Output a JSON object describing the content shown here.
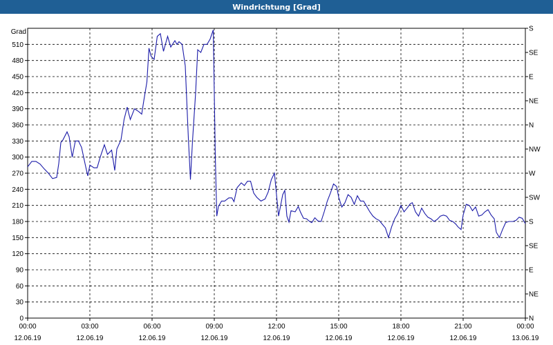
{
  "window": {
    "title": "Windrichtung [Grad]"
  },
  "colors": {
    "titlebar": "#1f5f95",
    "series": "#1a1aa8",
    "grid": "#000000"
  },
  "chart_data": {
    "type": "line",
    "title": "Windrichtung [Grad]",
    "ylabel": "Grad",
    "ylim": [
      0,
      540
    ],
    "yticks": [
      0,
      30,
      60,
      90,
      120,
      150,
      180,
      210,
      240,
      270,
      300,
      330,
      360,
      390,
      420,
      450,
      480,
      510
    ],
    "right_axis_labels": [
      "N",
      "NE",
      "E",
      "SE",
      "S",
      "SW",
      "W",
      "NW",
      "N",
      "NE",
      "E",
      "SE",
      "S"
    ],
    "right_axis_ticks": [
      0,
      45,
      90,
      135,
      180,
      225,
      270,
      315,
      360,
      405,
      450,
      495,
      540
    ],
    "xlim": [
      0,
      24
    ],
    "xticks": [
      {
        "x": 0,
        "time": "00:00",
        "date": "12.06.19"
      },
      {
        "x": 3,
        "time": "03:00",
        "date": "12.06.19"
      },
      {
        "x": 6,
        "time": "06:00",
        "date": "12.06.19"
      },
      {
        "x": 9,
        "time": "09:00",
        "date": "12.06.19"
      },
      {
        "x": 12,
        "time": "12:00",
        "date": "12.06.19"
      },
      {
        "x": 15,
        "time": "15:00",
        "date": "12.06.19"
      },
      {
        "x": 18,
        "time": "18:00",
        "date": "12.06.19"
      },
      {
        "x": 21,
        "time": "21:00",
        "date": "12.06.19"
      },
      {
        "x": 24,
        "time": "00:00",
        "date": "13.06.19"
      }
    ],
    "grid": true,
    "series": [
      {
        "points": [
          [
            0.0,
            282
          ],
          [
            0.2,
            292
          ],
          [
            0.4,
            292
          ],
          [
            0.6,
            287
          ],
          [
            0.8,
            278
          ],
          [
            1.0,
            270
          ],
          [
            1.1,
            265
          ],
          [
            1.2,
            260
          ],
          [
            1.4,
            262
          ],
          [
            1.5,
            288
          ],
          [
            1.6,
            327
          ],
          [
            1.7,
            332
          ],
          [
            1.9,
            347
          ],
          [
            2.0,
            338
          ],
          [
            2.15,
            300
          ],
          [
            2.3,
            330
          ],
          [
            2.45,
            330
          ],
          [
            2.6,
            318
          ],
          [
            2.8,
            282
          ],
          [
            2.9,
            265
          ],
          [
            3.0,
            285
          ],
          [
            3.2,
            280
          ],
          [
            3.35,
            280
          ],
          [
            3.5,
            300
          ],
          [
            3.7,
            323
          ],
          [
            3.85,
            305
          ],
          [
            4.05,
            313
          ],
          [
            4.2,
            275
          ],
          [
            4.3,
            315
          ],
          [
            4.5,
            332
          ],
          [
            4.65,
            370
          ],
          [
            4.8,
            393
          ],
          [
            4.95,
            370
          ],
          [
            5.15,
            390
          ],
          [
            5.35,
            385
          ],
          [
            5.5,
            380
          ],
          [
            5.6,
            405
          ],
          [
            5.75,
            440
          ],
          [
            5.85,
            503
          ],
          [
            5.95,
            488
          ],
          [
            6.1,
            482
          ],
          [
            6.25,
            525
          ],
          [
            6.4,
            530
          ],
          [
            6.55,
            497
          ],
          [
            6.75,
            525
          ],
          [
            6.9,
            505
          ],
          [
            7.1,
            517
          ],
          [
            7.2,
            510
          ],
          [
            7.3,
            515
          ],
          [
            7.45,
            510
          ],
          [
            7.6,
            470
          ],
          [
            7.75,
            335
          ],
          [
            7.85,
            258
          ],
          [
            7.95,
            330
          ],
          [
            8.1,
            420
          ],
          [
            8.2,
            500
          ],
          [
            8.35,
            495
          ],
          [
            8.5,
            510
          ],
          [
            8.65,
            510
          ],
          [
            8.8,
            520
          ],
          [
            8.95,
            537
          ],
          [
            9.05,
            300
          ],
          [
            9.12,
            190
          ],
          [
            9.2,
            208
          ],
          [
            9.35,
            218
          ],
          [
            9.5,
            218
          ],
          [
            9.7,
            224
          ],
          [
            9.85,
            224
          ],
          [
            9.95,
            217
          ],
          [
            10.1,
            243
          ],
          [
            10.3,
            252
          ],
          [
            10.45,
            247
          ],
          [
            10.6,
            255
          ],
          [
            10.75,
            255
          ],
          [
            10.9,
            233
          ],
          [
            11.05,
            225
          ],
          [
            11.25,
            218
          ],
          [
            11.45,
            222
          ],
          [
            11.6,
            235
          ],
          [
            11.75,
            258
          ],
          [
            11.9,
            270
          ],
          [
            12.0,
            230
          ],
          [
            12.1,
            190
          ],
          [
            12.2,
            210
          ],
          [
            12.3,
            230
          ],
          [
            12.4,
            238
          ],
          [
            12.5,
            190
          ],
          [
            12.6,
            179
          ],
          [
            12.7,
            200
          ],
          [
            12.9,
            198
          ],
          [
            13.05,
            208
          ],
          [
            13.15,
            198
          ],
          [
            13.3,
            186
          ],
          [
            13.45,
            185
          ],
          [
            13.6,
            180
          ],
          [
            13.7,
            178
          ],
          [
            13.85,
            187
          ],
          [
            14.0,
            181
          ],
          [
            14.15,
            180
          ],
          [
            14.3,
            198
          ],
          [
            14.45,
            218
          ],
          [
            14.6,
            233
          ],
          [
            14.75,
            250
          ],
          [
            14.9,
            245
          ],
          [
            15.0,
            225
          ],
          [
            15.15,
            207
          ],
          [
            15.3,
            215
          ],
          [
            15.45,
            230
          ],
          [
            15.6,
            225
          ],
          [
            15.75,
            212
          ],
          [
            15.9,
            228
          ],
          [
            16.05,
            218
          ],
          [
            16.2,
            218
          ],
          [
            16.35,
            208
          ],
          [
            16.5,
            198
          ],
          [
            16.65,
            190
          ],
          [
            16.8,
            185
          ],
          [
            16.95,
            182
          ],
          [
            17.1,
            175
          ],
          [
            17.25,
            168
          ],
          [
            17.4,
            150
          ],
          [
            17.55,
            170
          ],
          [
            17.7,
            185
          ],
          [
            17.85,
            195
          ],
          [
            18.0,
            210
          ],
          [
            18.15,
            198
          ],
          [
            18.3,
            205
          ],
          [
            18.45,
            213
          ],
          [
            18.55,
            215
          ],
          [
            18.7,
            198
          ],
          [
            18.85,
            190
          ],
          [
            19.0,
            205
          ],
          [
            19.15,
            195
          ],
          [
            19.3,
            188
          ],
          [
            19.45,
            185
          ],
          [
            19.6,
            180
          ],
          [
            19.75,
            184
          ],
          [
            19.9,
            190
          ],
          [
            20.05,
            192
          ],
          [
            20.2,
            190
          ],
          [
            20.35,
            182
          ],
          [
            20.5,
            180
          ],
          [
            20.65,
            175
          ],
          [
            20.75,
            170
          ],
          [
            20.9,
            165
          ],
          [
            21.0,
            192
          ],
          [
            21.15,
            212
          ],
          [
            21.3,
            210
          ],
          [
            21.45,
            200
          ],
          [
            21.6,
            207
          ],
          [
            21.75,
            190
          ],
          [
            21.9,
            192
          ],
          [
            22.05,
            198
          ],
          [
            22.2,
            202
          ],
          [
            22.35,
            192
          ],
          [
            22.5,
            185
          ],
          [
            22.6,
            160
          ],
          [
            22.75,
            150
          ],
          [
            22.9,
            165
          ],
          [
            23.05,
            178
          ],
          [
            23.2,
            180
          ],
          [
            23.4,
            180
          ],
          [
            23.55,
            182
          ],
          [
            23.7,
            188
          ],
          [
            23.85,
            186
          ],
          [
            24.0,
            176
          ]
        ]
      }
    ]
  }
}
